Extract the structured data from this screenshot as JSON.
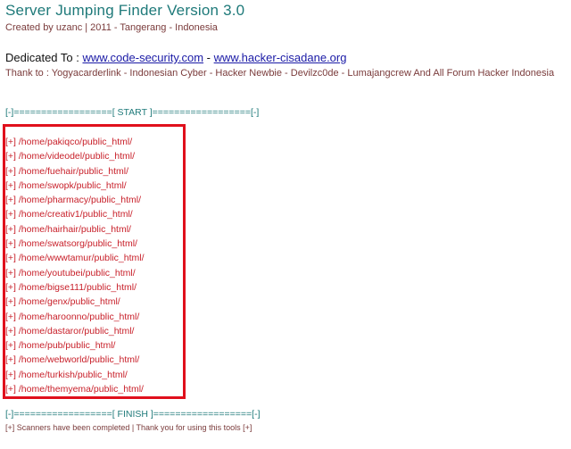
{
  "header": {
    "title": "Server Jumping Finder Version 3.0",
    "credit": "Created by uzanc | 2011 - Tangerang - Indonesia"
  },
  "dedication": {
    "prefix": "Dedicated To : ",
    "link1": "www.code-security.com",
    "joiner": " - ",
    "link2": "www.hacker-cisadane.org"
  },
  "thanks": "Thank to : Yogyacarderlink - Indonesian Cyber - Hacker Newbie - Devilzc0de - Lumajangcrew And All Forum Hacker Indonesia",
  "separators": {
    "start": "[-]==================[ START ]==================[-]",
    "finish": "[-]==================[ FINISH ]==================[-]"
  },
  "results": [
    "[+] /home/pakiqco/public_html/",
    "[+] /home/videodel/public_html/",
    "[+] /home/fuehair/public_html/",
    "[+] /home/swopk/public_html/",
    "[+] /home/pharmacy/public_html/",
    "[+] /home/creativ1/public_html/",
    "[+] /home/hairhair/public_html/",
    "[+] /home/swatsorg/public_html/",
    "[+] /home/wwwtamur/public_html/",
    "[+] /home/youtubei/public_html/",
    "[+] /home/bigse111/public_html/",
    "[+] /home/genx/public_html/",
    "[+] /home/haroonno/public_html/",
    "[+] /home/dastaror/public_html/",
    "[+] /home/pub/public_html/",
    "[+] /home/webworld/public_html/",
    "[+] /home/turkish/public_html/",
    "[+] /home/themyema/public_html/"
  ],
  "footer_note": "[+] Scanners have been completed | Thank you for using this tools [+]",
  "colors": {
    "title": "#1f7a7a",
    "result_text": "#c8202a",
    "highlight_box": "#e0101c",
    "link": "#1a1aa6"
  }
}
